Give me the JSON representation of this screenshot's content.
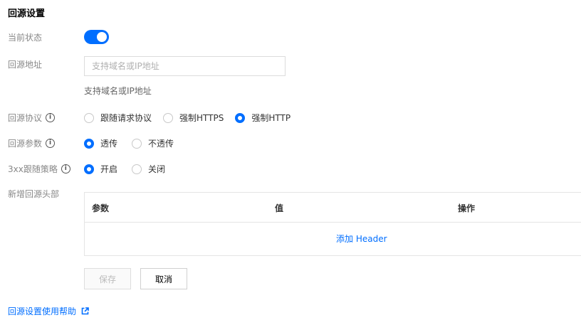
{
  "title": "回源设置",
  "status": {
    "label": "当前状态",
    "enabled": true
  },
  "address": {
    "label": "回源地址",
    "placeholder": "支持域名或IP地址",
    "hint": "支持域名或IP地址"
  },
  "protocol": {
    "label": "回源协议",
    "options": [
      "跟随请求协议",
      "强制HTTPS",
      "强制HTTP"
    ],
    "selected": "强制HTTP"
  },
  "params": {
    "label": "回源参数",
    "options": [
      "透传",
      "不透传"
    ],
    "selected": "透传"
  },
  "redirect": {
    "label": "3xx跟随策略",
    "options": [
      "开启",
      "关闭"
    ],
    "selected": "开启"
  },
  "headers": {
    "label": "新增回源头部",
    "columns": [
      "参数",
      "值",
      "操作"
    ],
    "add_label": "添加 Header"
  },
  "buttons": {
    "save": "保存",
    "cancel": "取消"
  },
  "help_link": "回源设置使用帮助",
  "colors": {
    "accent": "#006eff"
  }
}
